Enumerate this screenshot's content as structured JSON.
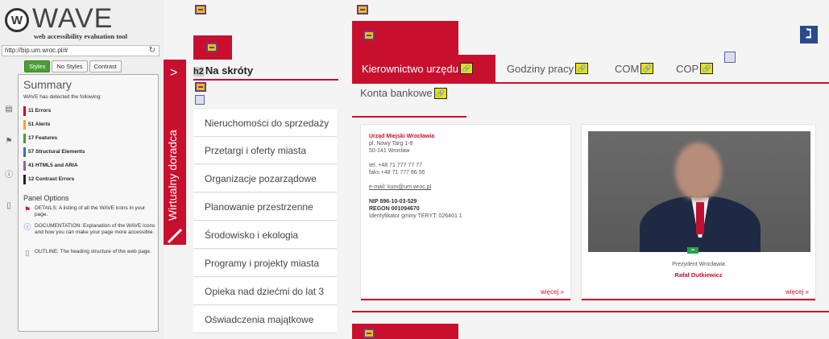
{
  "wave": {
    "logo_letter": "W",
    "logo_text": "WAVE",
    "subtitle": "web accessibility evaluation tool",
    "url": "http://bip.um.wroc.pl/#",
    "tabs": [
      "Styles",
      "No Styles",
      "Contrast"
    ],
    "summary_title": "Summary",
    "detected": "WAVE has detected the following:",
    "stats": [
      {
        "label": "11 Errors",
        "color": "#d0021b"
      },
      {
        "label": "51 Alerts",
        "color": "#f5a623"
      },
      {
        "label": "17 Features",
        "color": "#4a9e3a"
      },
      {
        "label": "57 Structural Elements",
        "color": "#3a6ec8"
      },
      {
        "label": "41 HTML5 and ARIA",
        "color": "#9b59b6"
      },
      {
        "label": "12 Contrast Errors",
        "color": "#222222"
      }
    ],
    "panel_options_title": "Panel Options",
    "panel_options": [
      {
        "icon": "flag-icon",
        "text": "DETAILS: A listing of all the WAVE icons in your page."
      },
      {
        "icon": "info-icon",
        "text": "DOCUMENTATION: Explanation of the WAVE icons and how you can make your page more accessible."
      },
      {
        "icon": "outline-icon",
        "text": "OUTLINE: The heading structure of the web page."
      }
    ]
  },
  "advisor": {
    "label": "Wirtualny doradca"
  },
  "nav": {
    "heading_tag": "h2",
    "title": "Na skróty",
    "items": [
      "Nieruchomości do sprzedaży",
      "Przetargi i oferty miasta",
      "Organizacje pozarządowe",
      "Planowanie przestrzenne",
      "Środowisko i ekologia",
      "Programy i projekty miasta",
      "Opieka nad dziećmi do lat 3",
      "Oświadczenia majątkowe"
    ]
  },
  "tabs": {
    "active": "Kierownictwo urzędu",
    "items": [
      "Godziny pracy",
      "COM",
      "COP"
    ],
    "konta": "Konta bankowe"
  },
  "office": {
    "name": "Urząd Miejski Wrocławia",
    "address1": "pl. Nowy Targ 1-8",
    "address2": "50-141 Wrocław",
    "tel": "tel. +48 71 777 77 77",
    "fax": "faks +48 71 777 86 55",
    "email": "e-mail: kum@um.wroc.pl",
    "nip": "NIP 896-10-03-529",
    "regon": "REGON 001094670",
    "teryt": "Identyfikator gminy TERYT: 026401 1",
    "more": "więcej »"
  },
  "president": {
    "title": "Prezydent Wrocławia",
    "name": "Rafał Dutkiewicz",
    "more": "więcej »"
  }
}
